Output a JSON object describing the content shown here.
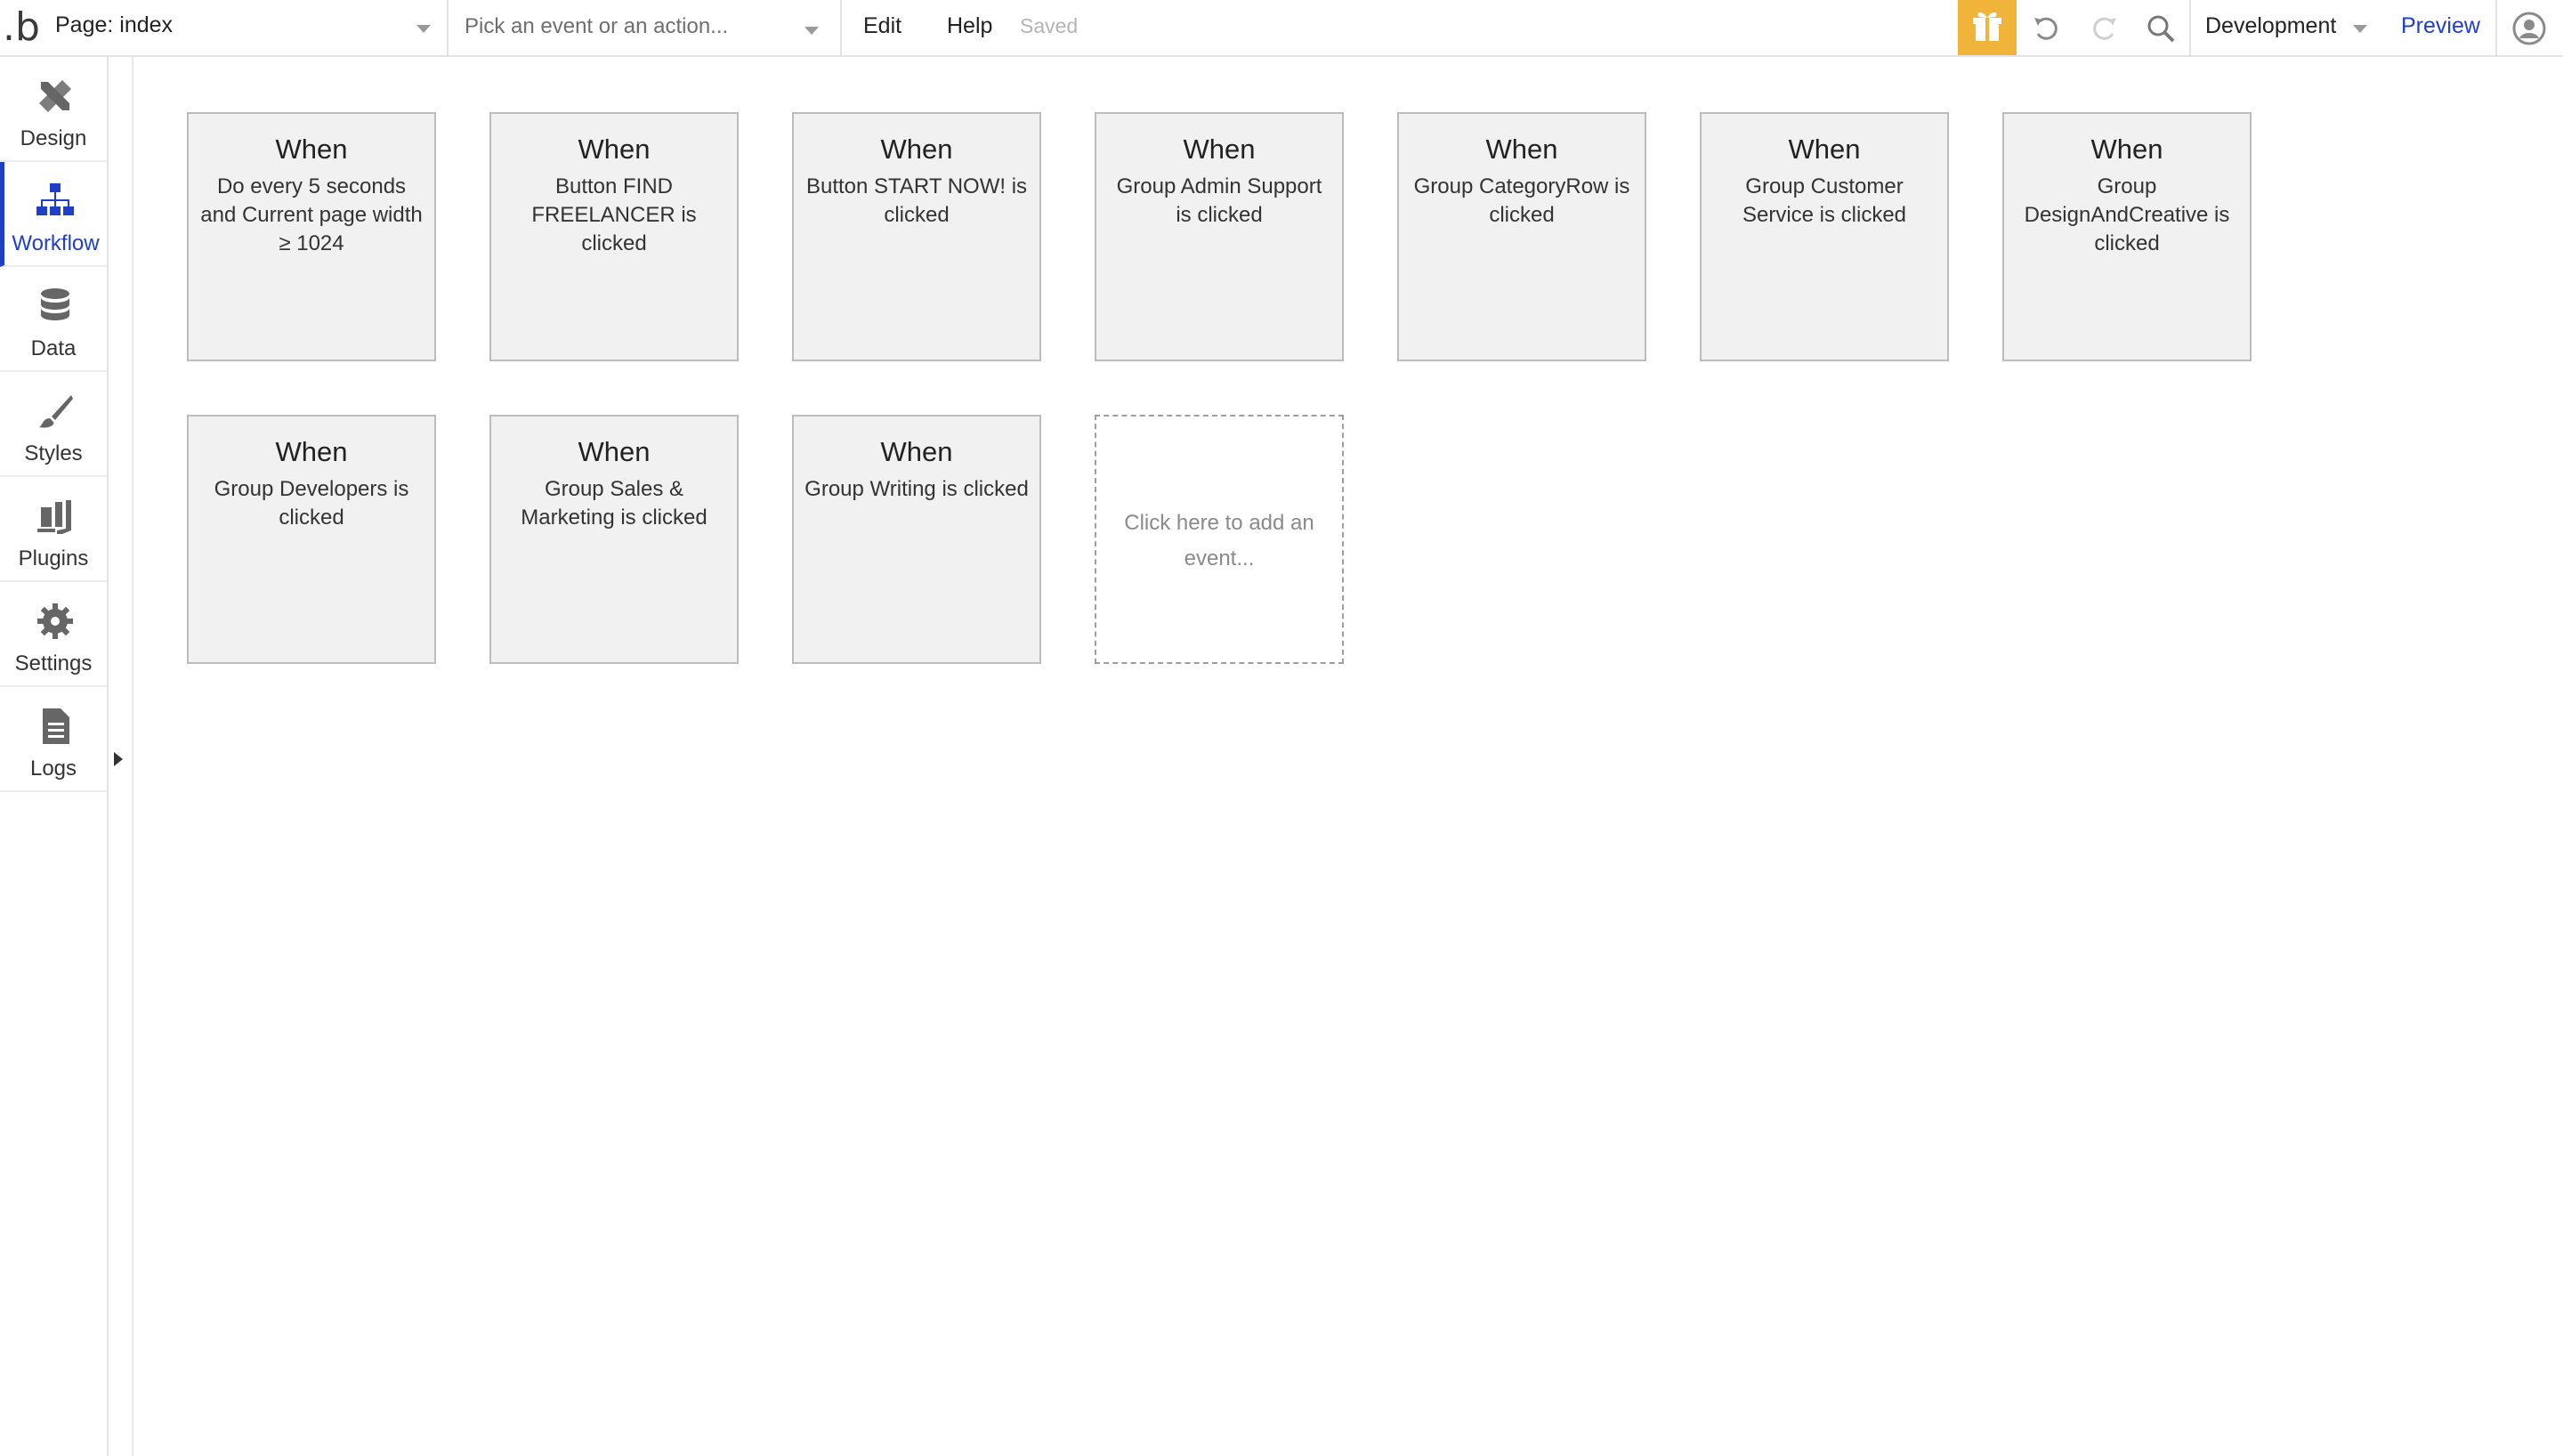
{
  "header": {
    "page_selector": "Page: index",
    "event_picker_placeholder": "Pick an event or an action...",
    "menu": {
      "edit": "Edit",
      "help": "Help"
    },
    "status": "Saved",
    "environment": "Development",
    "preview": "Preview",
    "accent_color": "#f1b43a",
    "link_color": "#1f3fc7"
  },
  "sidebar": {
    "items": [
      {
        "label": "Design",
        "icon": "design-tools-icon"
      },
      {
        "label": "Workflow",
        "icon": "workflow-icon",
        "active": true
      },
      {
        "label": "Data",
        "icon": "database-icon"
      },
      {
        "label": "Styles",
        "icon": "brush-icon"
      },
      {
        "label": "Plugins",
        "icon": "plugins-icon"
      },
      {
        "label": "Settings",
        "icon": "gear-icon"
      },
      {
        "label": "Logs",
        "icon": "document-icon"
      }
    ]
  },
  "events": [
    {
      "heading": "When",
      "text": "Do every 5 seconds and Current page width ≥ 1024"
    },
    {
      "heading": "When",
      "text": "Button FIND FREELANCER is clicked"
    },
    {
      "heading": "When",
      "text": "Button START NOW! is clicked"
    },
    {
      "heading": "When",
      "text": "Group Admin Support is clicked"
    },
    {
      "heading": "When",
      "text": "Group CategoryRow is clicked"
    },
    {
      "heading": "When",
      "text": "Group Customer Service is clicked"
    },
    {
      "heading": "When",
      "text": "Group DesignAndCreative is clicked"
    },
    {
      "heading": "When",
      "text": "Group Developers is clicked"
    },
    {
      "heading": "When",
      "text": "Group Sales & Marketing is clicked"
    },
    {
      "heading": "When",
      "text": "Group Writing is clicked"
    }
  ],
  "add_event": "Click here to add an event..."
}
